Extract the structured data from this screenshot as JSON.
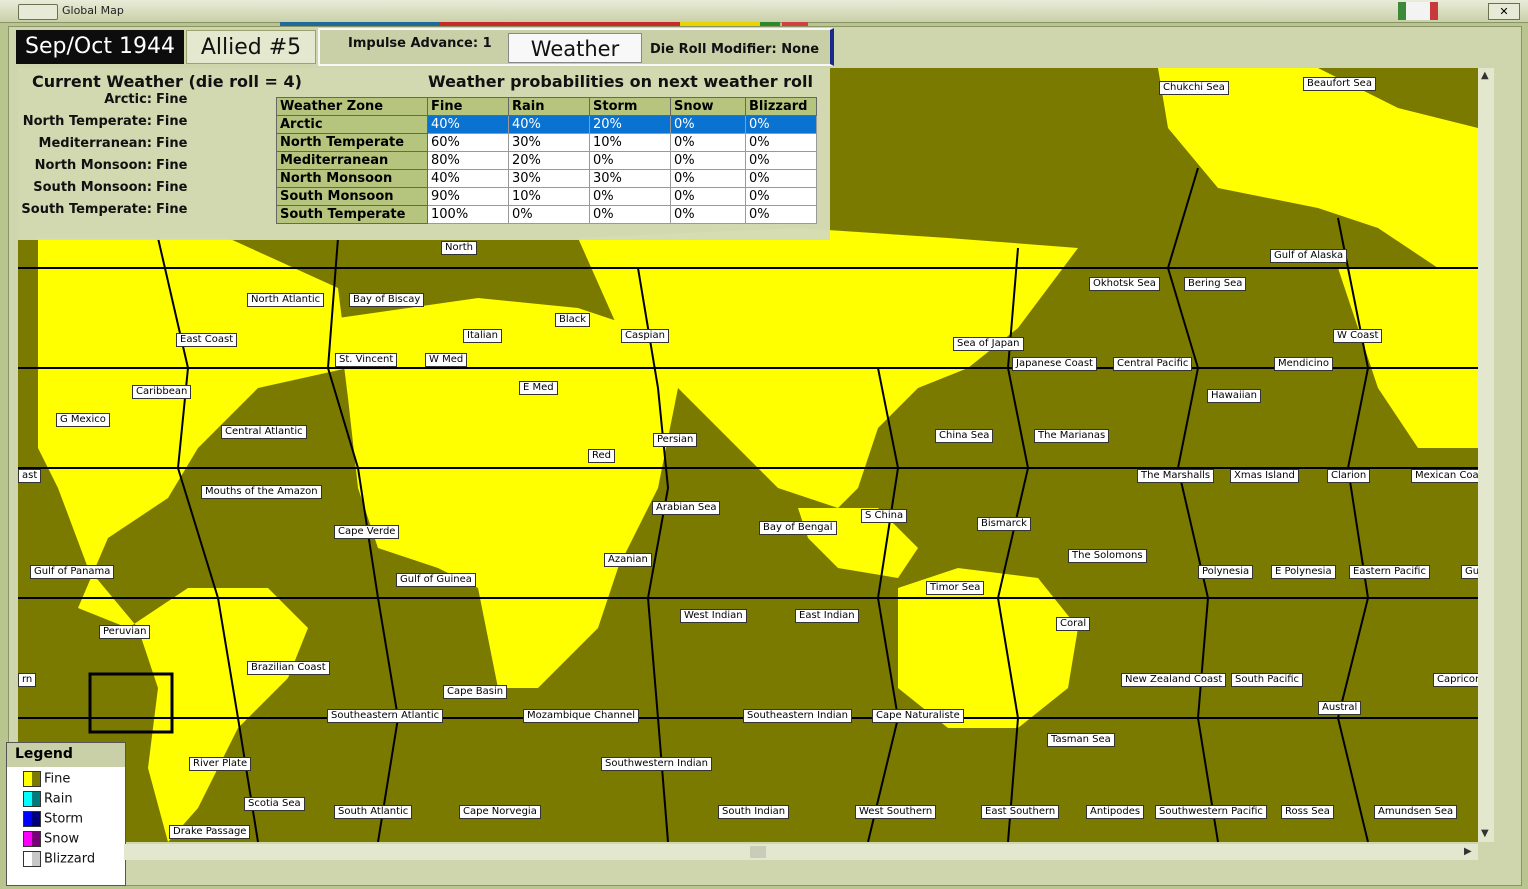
{
  "window": {
    "title": "Global Map"
  },
  "header": {
    "date": "Sep/Oct 1944",
    "turn": "Allied #5",
    "impulse_label": "Impulse Advance:",
    "impulse_value": "1",
    "weather_button": "Weather",
    "die_mod_label": "Die Roll Modifier:",
    "die_mod_value": "None"
  },
  "current_weather": {
    "title": "Current Weather (die roll = 4)",
    "zones": [
      {
        "zone": "Arctic:",
        "weather": "Fine"
      },
      {
        "zone": "North Temperate:",
        "weather": "Fine"
      },
      {
        "zone": "Mediterranean:",
        "weather": "Fine"
      },
      {
        "zone": "North Monsoon:",
        "weather": "Fine"
      },
      {
        "zone": "South Monsoon:",
        "weather": "Fine"
      },
      {
        "zone": "South Temperate:",
        "weather": "Fine"
      }
    ]
  },
  "probabilities": {
    "title": "Weather probabilities on next weather roll",
    "columns": [
      "Weather Zone",
      "Fine",
      "Rain",
      "Storm",
      "Snow",
      "Blizzard"
    ],
    "rows": [
      [
        "Arctic",
        "40%",
        "40%",
        "20%",
        "0%",
        "0%"
      ],
      [
        "North Temperate",
        "60%",
        "30%",
        "10%",
        "0%",
        "0%"
      ],
      [
        "Mediterranean",
        "80%",
        "20%",
        "0%",
        "0%",
        "0%"
      ],
      [
        "North Monsoon",
        "40%",
        "30%",
        "30%",
        "0%",
        "0%"
      ],
      [
        "South Monsoon",
        "90%",
        "10%",
        "0%",
        "0%",
        "0%"
      ],
      [
        "South Temperate",
        "100%",
        "0%",
        "0%",
        "0%",
        "0%"
      ]
    ],
    "selected_row": 0
  },
  "legend": {
    "title": "Legend",
    "items": [
      {
        "label": "Fine",
        "c1": "#ffff00",
        "c2": "#7a7a00"
      },
      {
        "label": "Rain",
        "c1": "#00ffff",
        "c2": "#007a7a"
      },
      {
        "label": "Storm",
        "c1": "#0000ff",
        "c2": "#00007a"
      },
      {
        "label": "Snow",
        "c1": "#ff00ff",
        "c2": "#7a007a"
      },
      {
        "label": "Blizzard",
        "c1": "#ffffff",
        "c2": "#c8c8c8"
      }
    ]
  },
  "map_labels": [
    "North",
    "North Atlantic",
    "Bay of Biscay",
    "East Coast",
    "Italian",
    "Black",
    "Caspian",
    "St. Vincent",
    "W Med",
    "E Med",
    "Caribbean",
    "G Mexico",
    "Central Atlantic",
    "Persian",
    "Red",
    "Mouths of the Amazon",
    "Cape Verde",
    "Arabian Sea",
    "Bay of Bengal",
    "Azanian",
    "Gulf of Guinea",
    "Gulf of Panama",
    "Peruvian",
    "West Indian",
    "East Indian",
    "Brazilian Coast",
    "Cape Basin",
    "Southeastern Atlantic",
    "Mozambique Channel",
    "Southeastern Indian",
    "Cape Naturaliste",
    "Southwestern Indian",
    "River Plate",
    "Scotia Sea",
    "South Atlantic",
    "Cape Norvegia",
    "South Indian",
    "West Southern",
    "East Southern",
    "Drake Passage",
    "Chukchi Sea",
    "Beaufort Sea",
    "Okhotsk Sea",
    "Bering Sea",
    "Gulf of Alaska",
    "W Coast",
    "Sea of Japan",
    "Japanese Coast",
    "Central Pacific",
    "Mendicino",
    "Hawaiian",
    "China Sea",
    "The Marianas",
    "The Marshalls",
    "Xmas Island",
    "Clarion",
    "Mexican Coast",
    "S China",
    "Bismarck",
    "The Solomons",
    "Polynesia",
    "E Polynesia",
    "Eastern Pacific",
    "Gulf",
    "Timor Sea",
    "Coral",
    "New Zealand Coast",
    "South Pacific",
    "Capricorn",
    "Austral",
    "Tasman Sea",
    "Antipodes",
    "Southwestern Pacific",
    "Ross Sea",
    "Amundsen Sea",
    "ast",
    "rn"
  ]
}
